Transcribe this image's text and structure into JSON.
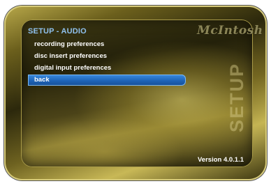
{
  "screen": {
    "title": "SETUP - AUDIO",
    "brand": "McIntosh",
    "watermark": "SETUP",
    "version": "Version 4.0.1.1"
  },
  "menu": {
    "items": [
      {
        "label": "recording preferences",
        "selected": false
      },
      {
        "label": "disc insert preferences",
        "selected": false
      },
      {
        "label": "digital input preferences",
        "selected": false
      },
      {
        "label": "back",
        "selected": true
      }
    ]
  },
  "colors": {
    "title": "#8fc0ee",
    "selection": "#1e64b8",
    "text": "#ffffff",
    "frame": "#6b5f1c"
  }
}
